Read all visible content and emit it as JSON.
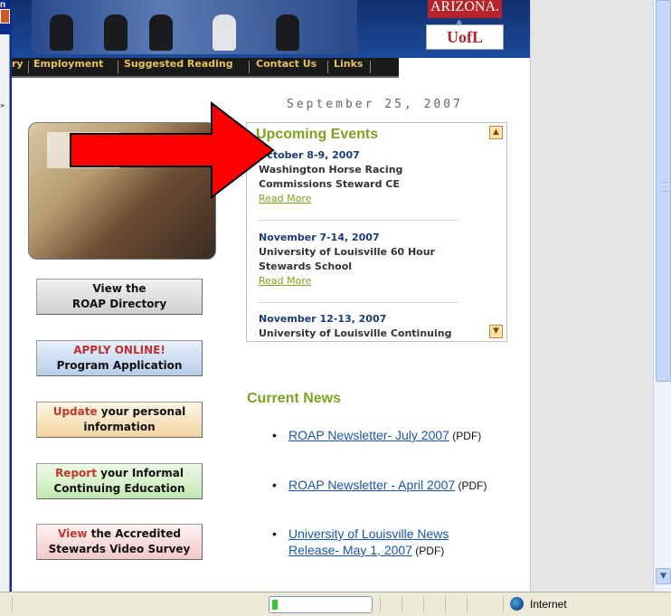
{
  "window": {
    "left_fragment": "n"
  },
  "header": {
    "logo_top": "ARIZONA.",
    "logo_amp": "&",
    "logo_bottom": "UofL"
  },
  "nav": {
    "items": [
      {
        "label": "ry"
      },
      {
        "label": "Employment"
      },
      {
        "label": "Suggested Reading"
      },
      {
        "label": "Contact Us"
      },
      {
        "label": "Links"
      }
    ]
  },
  "date": "September 25, 2007",
  "sidebar": {
    "directory": {
      "line1": "View the",
      "line2": "ROAP Directory"
    },
    "apply": {
      "line1": "APPLY ONLINE!",
      "line2": "Program Application"
    },
    "update": {
      "hl": "Update",
      "rest": " your personal",
      "line2": "information"
    },
    "report": {
      "hl": "Report",
      "rest": " your Informal",
      "line2": "Continuing Education"
    },
    "view": {
      "hl": "View",
      "rest": " the Accredited",
      "line2": "Stewards Video Survey"
    }
  },
  "events": {
    "title": "Upcoming Events",
    "items": [
      {
        "date": "October 8-9, 2007",
        "line1": "Washington Horse Racing",
        "line2": "Commissions Steward CE",
        "more": "Read More"
      },
      {
        "date": "November 7-14, 2007",
        "line1": "University of Louisville 60 Hour",
        "line2": "Stewards School",
        "more": "Read More"
      },
      {
        "date": "November 12-13, 2007",
        "line1": "University of Louisville Continuing"
      }
    ]
  },
  "news": {
    "title": "Current News",
    "items": [
      {
        "link": "ROAP Newsletter- July 2007",
        "suffix": " (PDF)"
      },
      {
        "link": "ROAP Newsletter - April 2007",
        "suffix": " (PDF)"
      },
      {
        "link_line1": "University of Louisville News",
        "link_line2": "Release- May 1, 2007",
        "suffix": " (PDF)"
      }
    ]
  },
  "statusbar": {
    "zone": "Internet"
  },
  "colors": {
    "accent_green": "#7da21d",
    "date_blue": "#1b3a7a",
    "arrow_red": "#ff0000",
    "link_blue": "#1a56b0"
  },
  "icons": [
    "scroll-up-icon",
    "scroll-down-icon",
    "globe-icon",
    "chevron-down-icon"
  ]
}
